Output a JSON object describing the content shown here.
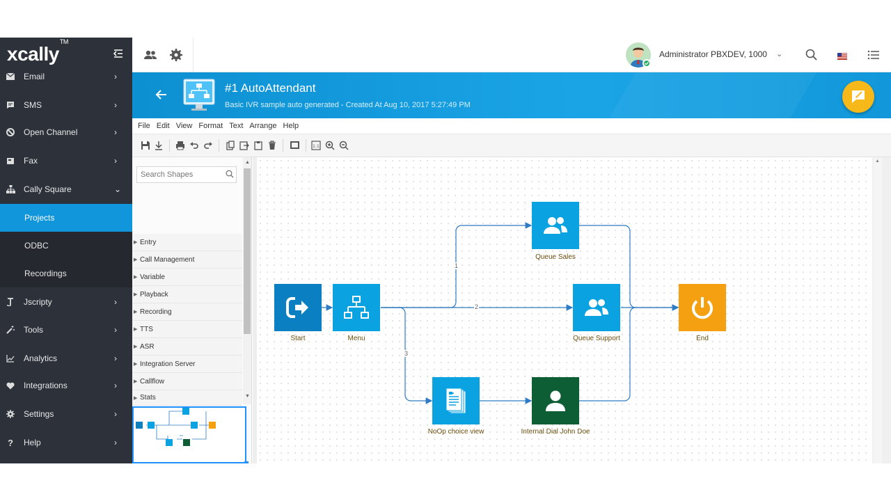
{
  "sidebar": {
    "logo": "xcally",
    "logo_tm": "TM",
    "items": [
      {
        "label": "Email",
        "icon": "envelope-icon"
      },
      {
        "label": "SMS",
        "icon": "sms-icon"
      },
      {
        "label": "Open Channel",
        "icon": "open-channel-icon"
      },
      {
        "label": "Fax",
        "icon": "fax-icon"
      },
      {
        "label": "Cally Square",
        "icon": "sitemap-icon"
      },
      {
        "label": "Projects"
      },
      {
        "label": "ODBC"
      },
      {
        "label": "Recordings"
      },
      {
        "label": "Jscripty",
        "icon": "jscripty-icon"
      },
      {
        "label": "Tools",
        "icon": "wand-icon"
      },
      {
        "label": "Analytics",
        "icon": "chart-line-icon"
      },
      {
        "label": "Integrations",
        "icon": "heart-icon"
      },
      {
        "label": "Settings",
        "icon": "gear-icon"
      },
      {
        "label": "Help",
        "icon": "question-icon"
      }
    ]
  },
  "topbar": {
    "user_name": "Administrator PBXDEV, 1000",
    "status_color": "#27ae60"
  },
  "header": {
    "title": "#1 AutoAttendant",
    "subtitle": "Basic IVR sample auto generated - Created At Aug 10, 2017 5:27:49 PM"
  },
  "menubar": [
    "File",
    "Edit",
    "View",
    "Format",
    "Text",
    "Arrange",
    "Help"
  ],
  "shapes": {
    "search_placeholder": "Search Shapes",
    "categories": [
      "Entry",
      "Call Management",
      "Variable",
      "Playback",
      "Recording",
      "TTS",
      "ASR",
      "Integration Server",
      "Callflow",
      "Stats"
    ]
  },
  "diagram": {
    "nodes": {
      "start": "Start",
      "menu": "Menu",
      "queue_sales": "Queue Sales",
      "queue_support": "Queue Support",
      "end": "End",
      "noop": "NoOp choice view",
      "internal_dial": "Internal Dial John Doe"
    },
    "edges": {
      "e1": "1",
      "e2": "2",
      "e3": "3"
    }
  },
  "colors": {
    "accent": "#1296db",
    "sidebar_bg": "#2d323a",
    "node_blue_dark": "#0a7fc2",
    "node_blue": "#0aa2e0",
    "node_orange": "#f5a010",
    "node_green": "#0d5e35",
    "edge": "#2d7bc4",
    "fab": "#f7b81a"
  }
}
